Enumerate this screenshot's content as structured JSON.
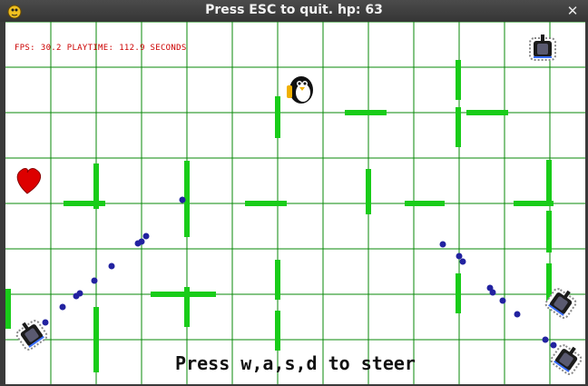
{
  "window": {
    "title": "Press ESC to quit. hp: 63",
    "app_icon": "pygame-snake-icon",
    "close_icon": "close-x-icon"
  },
  "hud": {
    "fps_label": "FPS:",
    "fps_value": "30.2",
    "playtime_label": "PLAYTIME:",
    "playtime_value": "112.9 SECONDS"
  },
  "instructions": "Press w,a,s,d to steer",
  "colors": {
    "grid": "#0a8a0a",
    "walls": "#19cc19",
    "bullets": "#2222a0",
    "heart": "#dd0000",
    "hud_text": "#cc0000",
    "background": "#ffffff"
  },
  "sprites": {
    "player": "tux-penguin",
    "enemies": "tank-sprite",
    "pickup": "heart"
  }
}
